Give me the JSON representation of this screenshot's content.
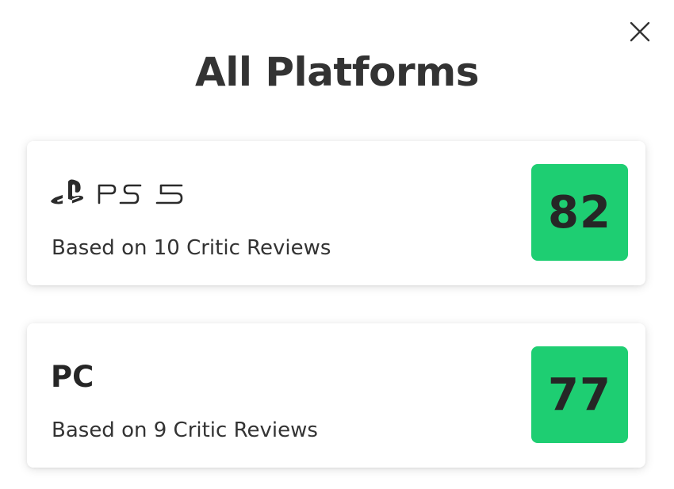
{
  "modal": {
    "title": "All Platforms",
    "close_icon": "close-icon"
  },
  "platforms": [
    {
      "name": "PS5",
      "logo_icon": "playstation-5-logo",
      "reviews": "Based on 10 Critic Reviews",
      "score": "82",
      "score_color": "#1ece72"
    },
    {
      "name": "PC",
      "reviews": "Based on 9 Critic Reviews",
      "score": "77",
      "score_color": "#1ece72"
    }
  ],
  "colors": {
    "score_positive": "#1ece72",
    "text_dark": "#262626"
  }
}
